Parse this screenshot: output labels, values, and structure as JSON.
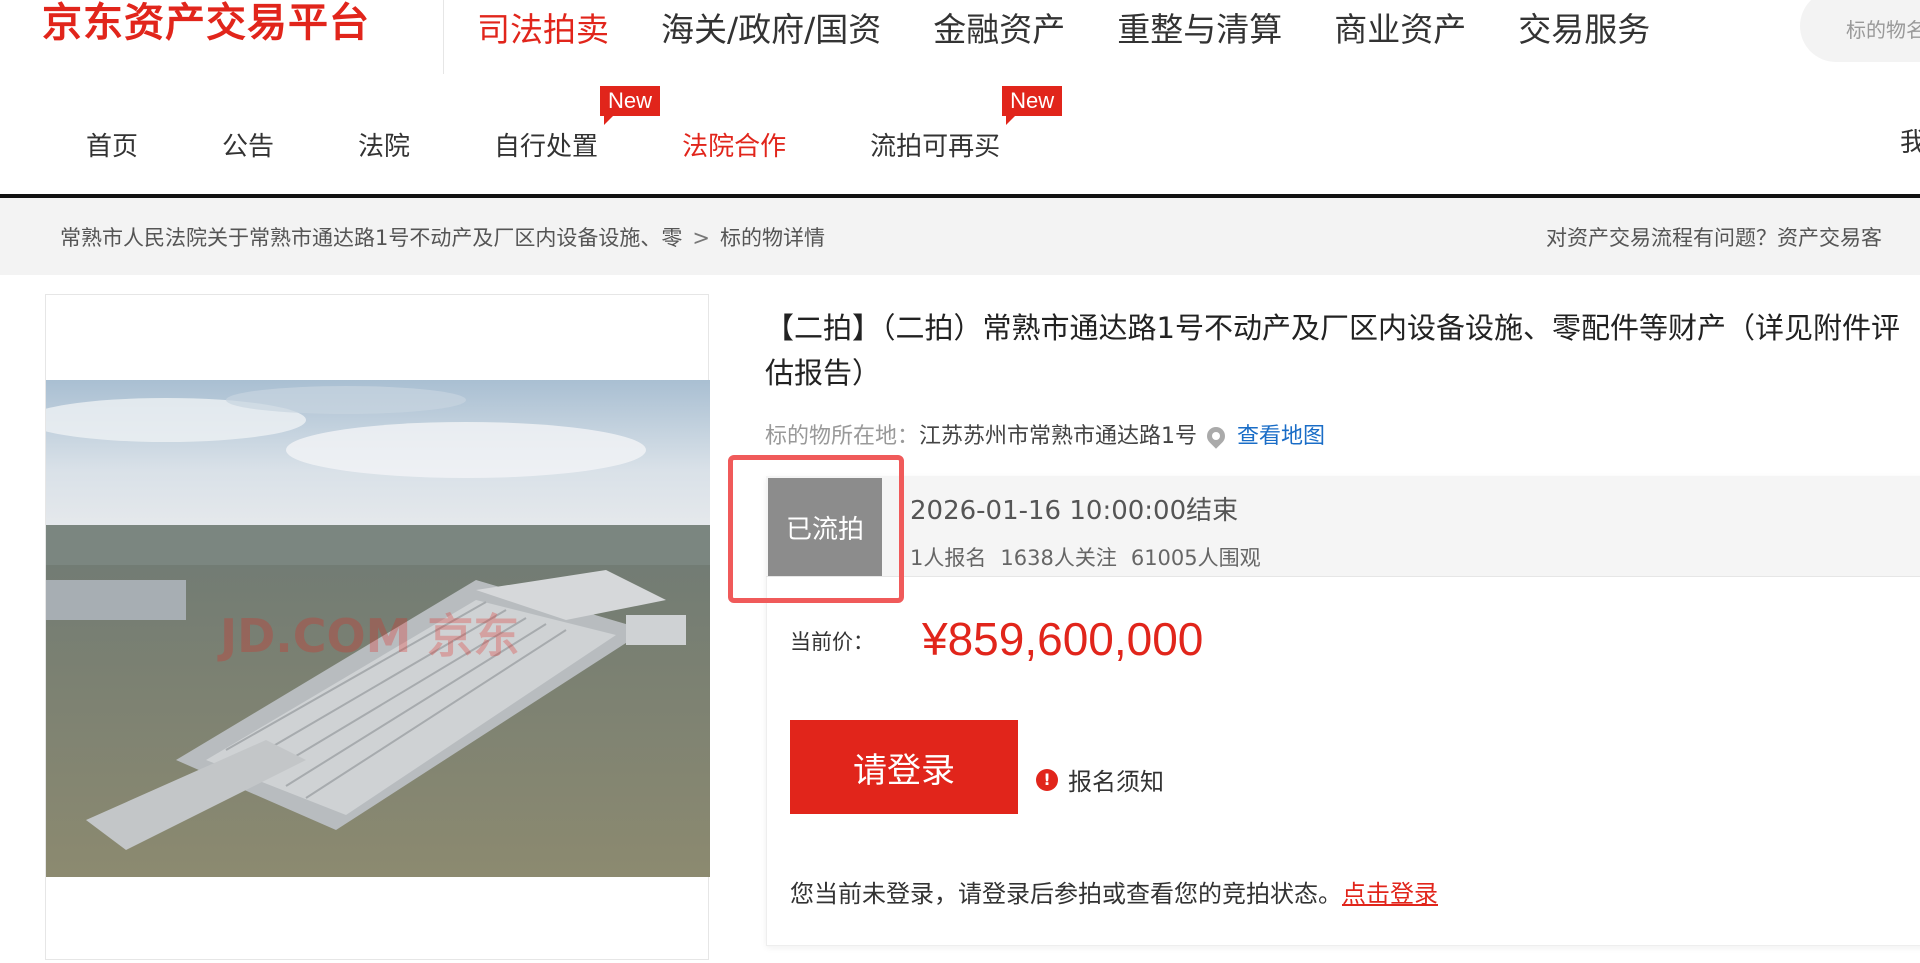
{
  "header": {
    "logo": "京东资产交易平台",
    "nav": [
      "司法拍卖",
      "海关/政府/国资",
      "金融资产",
      "重整与清算",
      "商业资产",
      "交易服务"
    ],
    "search_placeholder": "标的物名"
  },
  "subnav": {
    "items": [
      "首页",
      "公告",
      "法院",
      "自行处置",
      "法院合作",
      "流拍可再买"
    ],
    "new_badge": "New",
    "right_text": "我"
  },
  "breadcrumb": {
    "parent": "常熟市人民法院关于常熟市通达路1号不动产及厂区内设备设施、零",
    "separator": ">",
    "current": "标的物详情",
    "help": "对资产交易流程有问题？资产交易客"
  },
  "image": {
    "watermark": "JD.COM 京东"
  },
  "item": {
    "title": "【二拍】（二拍）常熟市通达路1号不动产及厂区内设备设施、零配件等财产（详见附件评估报告）",
    "location_label": "标的物所在地：",
    "location": "江苏苏州市常熟市通达路1号",
    "map_link": "查看地图",
    "status": "已流拍",
    "end_time": "2026-01-16 10:00:00结束",
    "signups": "1人报名",
    "followers": "1638人关注",
    "views": "61005人围观",
    "price_label": "当前价：",
    "price": "¥859,600,000",
    "login_button": "请登录",
    "notice": "报名须知",
    "login_message": "您当前未登录，请登录后参拍或查看您的竞拍状态。",
    "login_link": "点击登录"
  },
  "colors": {
    "brand_red": "#e1251b",
    "status_gray": "#8c8c8c",
    "highlight": "#f05a5a",
    "link_blue": "#1a6dc7"
  }
}
